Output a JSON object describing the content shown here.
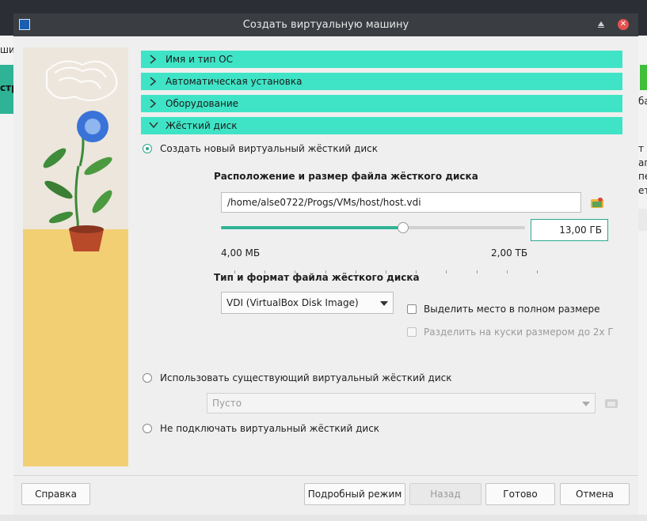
{
  "window": {
    "title": "Создать виртуальную машину"
  },
  "background_app": {
    "left_fragment_1": "ши",
    "left_fragment_2": "стр",
    "right_fragment_1": "ба",
    "right_fragment_2": "т",
    "right_fragment_3": "ап",
    "right_fragment_4": "пе",
    "right_fragment_5": "ет",
    "accent": "#2fb396"
  },
  "sections": [
    {
      "label": "Имя и тип ОС",
      "expanded": false
    },
    {
      "label": "Автоматическая установка",
      "expanded": false
    },
    {
      "label": "Оборудование",
      "expanded": false
    },
    {
      "label": "Жёсткий диск",
      "expanded": true
    }
  ],
  "disk": {
    "option_create": "Создать новый виртуальный жёсткий диск",
    "location_heading": "Расположение и размер файла жёсткого диска",
    "path_value": "/home/alse0722/Progs/VMs/host/host.vdi",
    "size_value": "13,00 ГБ",
    "size_fraction": 0.6,
    "min_label": "4,00 МБ",
    "max_label": "2,00 ТБ",
    "format_heading": "Тип и формат файла жёсткого диска",
    "format_selected": "VDI (VirtualBox Disk Image)",
    "preallocate_label": "Выделить место в полном размере",
    "split_label": "Разделить на куски размером до 2х Г",
    "option_existing": "Использовать существующий виртуальный жёсткий диск",
    "existing_placeholder": "Пусто",
    "option_none": "Не подключать виртуальный жёсткий диск"
  },
  "buttons": {
    "help": "Справка",
    "expert": "Подробный режим",
    "back": "Назад",
    "finish": "Готово",
    "cancel": "Отмена"
  },
  "colors": {
    "section_bg": "#3fe4c6",
    "accent": "#29a98f",
    "titlebar": "#3a3d42",
    "close": "#e3524f"
  }
}
